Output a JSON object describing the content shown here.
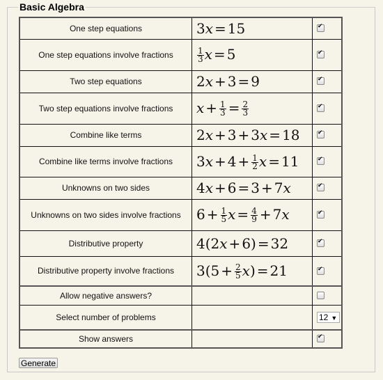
{
  "fieldset": {
    "legend": "Basic Algebra"
  },
  "rows": [
    {
      "label": "One step equations",
      "checked": true
    },
    {
      "label": "One step equations involve fractions",
      "checked": true
    },
    {
      "label": "Two step equations",
      "checked": true
    },
    {
      "label": "Two step equations involve fractions",
      "checked": true
    },
    {
      "label": "Combine like terms",
      "checked": true
    },
    {
      "label": "Combine like terms involve fractions",
      "checked": true
    },
    {
      "label": "Unknowns on two sides",
      "checked": true
    },
    {
      "label": "Unknowns on two sides involve fractions",
      "checked": true
    },
    {
      "label": "Distributive property",
      "checked": true
    },
    {
      "label": "Distributive property involve fractions",
      "checked": true
    }
  ],
  "equations": {
    "e0": [
      "3",
      "x",
      "=",
      "15"
    ],
    "e1": {
      "pre_num": "1",
      "pre_den": "3",
      "rest_var": "x",
      "eq": "=",
      "rhs": "5"
    },
    "e2": [
      "2",
      "x",
      "+",
      "3",
      "=",
      "9"
    ],
    "e3": {
      "var": "x",
      "plus": "+",
      "n1": "1",
      "d1": "3",
      "eq": "=",
      "n2": "2",
      "d2": "3"
    },
    "e4": [
      "2",
      "x",
      "+",
      "3",
      "+",
      "3",
      "x",
      "=",
      "18"
    ],
    "e5": {
      "a": "3",
      "var": "x",
      "p1": "+",
      "b": "4",
      "p2": "+",
      "n": "1",
      "d": "2",
      "var2": "x",
      "eq": "=",
      "rhs": "11"
    },
    "e6": [
      "4",
      "x",
      "+",
      "6",
      "=",
      "3",
      "+",
      "7",
      "x"
    ],
    "e7": {
      "a": "6",
      "p1": "+",
      "n1": "1",
      "d1": "5",
      "var": "x",
      "eq": "=",
      "n2": "4",
      "d2": "9",
      "p2": "+",
      "b": "7",
      "var2": "x"
    },
    "e8": [
      "4(2",
      "x",
      "+",
      "6)",
      "=",
      "32"
    ],
    "e9": {
      "a": "3(5",
      "p": "+",
      "n": "2",
      "d": "5",
      "var": "x",
      "close": ")",
      "eq": "=",
      "rhs": "21"
    }
  },
  "options": {
    "negative_label": "Allow negative answers?",
    "negative_checked": false,
    "count_label": "Select number of problems",
    "count_value": "12",
    "answers_label": "Show answers",
    "answers_checked": true
  },
  "generate_label": "Generate"
}
